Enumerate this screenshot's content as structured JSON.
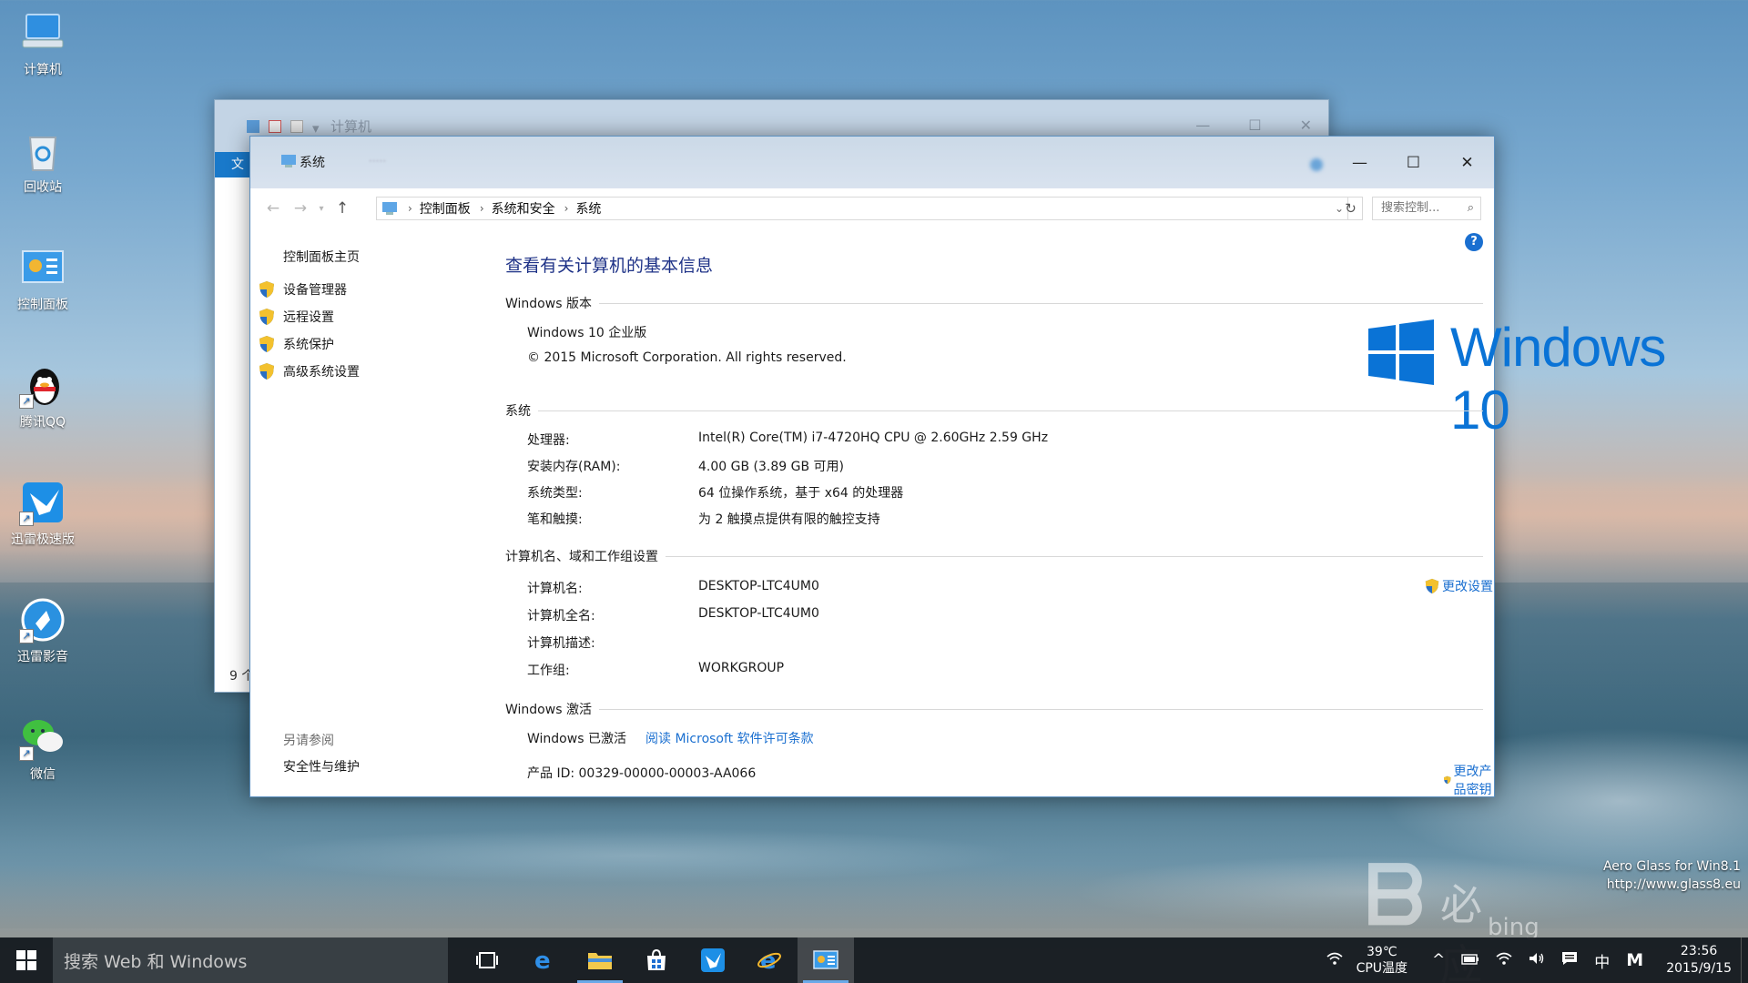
{
  "desktop": {
    "icons": [
      {
        "label": "计算机",
        "icon": "computer-icon"
      },
      {
        "label": "回收站",
        "icon": "recycle-bin-icon"
      },
      {
        "label": "控制面板",
        "icon": "control-panel-icon"
      },
      {
        "label": "腾讯QQ",
        "icon": "qq-penguin-icon"
      },
      {
        "label": "迅雷极速版",
        "icon": "xunlei-bird-icon"
      },
      {
        "label": "迅雷影音",
        "icon": "xunlei-player-icon"
      },
      {
        "label": "微信",
        "icon": "wechat-icon"
      }
    ]
  },
  "bg_window": {
    "title": "计算机",
    "file_tab": "文",
    "status": "9 个"
  },
  "main_window": {
    "title": "系统",
    "blurred_text": "·····",
    "controls": {
      "minimize": "—",
      "maximize": "☐",
      "close": "✕"
    },
    "address": {
      "crumbs": [
        "控制面板",
        "系统和安全",
        "系统"
      ],
      "search_placeholder": "搜索控制..."
    },
    "sidebar": {
      "home": "控制面板主页",
      "items": [
        "设备管理器",
        "远程设置",
        "系统保护",
        "高级系统设置"
      ],
      "see_also": "另请参阅",
      "see_also_link": "安全性与维护"
    },
    "page_title": "查看有关计算机的基本信息",
    "edition": {
      "heading": "Windows 版本",
      "name": "Windows 10 企业版",
      "copyright": "© 2015 Microsoft Corporation. All rights reserved.",
      "logo_text": "Windows 10"
    },
    "system": {
      "heading": "系统",
      "rows": [
        {
          "label": "处理器:",
          "value": "Intel(R) Core(TM) i7-4720HQ CPU @ 2.60GHz   2.59 GHz"
        },
        {
          "label": "安装内存(RAM):",
          "value": "4.00 GB (3.89 GB 可用)"
        },
        {
          "label": "系统类型:",
          "value": "64 位操作系统，基于 x64 的处理器"
        },
        {
          "label": "笔和触摸:",
          "value": "为 2 触摸点提供有限的触控支持"
        }
      ]
    },
    "computer_name": {
      "heading": "计算机名、域和工作组设置",
      "change_link": "更改设置",
      "rows": [
        {
          "label": "计算机名:",
          "value": "DESKTOP-LTC4UM0"
        },
        {
          "label": "计算机全名:",
          "value": "DESKTOP-LTC4UM0"
        },
        {
          "label": "计算机描述:",
          "value": ""
        },
        {
          "label": "工作组:",
          "value": "WORKGROUP"
        }
      ]
    },
    "activation": {
      "heading": "Windows 激活",
      "status": "Windows 已激活",
      "license_link": "阅读 Microsoft 软件许可条款",
      "product_id": "产品 ID: 00329-00000-00003-AA066",
      "change_key_link": "更改产品密钥"
    }
  },
  "watermark": {
    "aero_line1": "Aero Glass for Win8.1",
    "aero_line2": "http://www.glass8.eu",
    "bing_cn": "必应",
    "bing_en": "bing"
  },
  "taskbar": {
    "search_text": "搜索 Web 和 Windows",
    "apps": [
      "task-view-icon",
      "edge-icon",
      "file-explorer-icon",
      "store-icon",
      "xunlei-bird-icon",
      "ie-icon",
      "control-panel-icon"
    ],
    "temp_value": "39℃",
    "temp_label": "CPU温度",
    "ime": "中",
    "ime_mode": "M",
    "time": "23:56",
    "date": "2015/9/15"
  },
  "colors": {
    "link": "#1a6fd0",
    "title_blue": "#1e3287",
    "win_logo": "#0a73d6"
  }
}
